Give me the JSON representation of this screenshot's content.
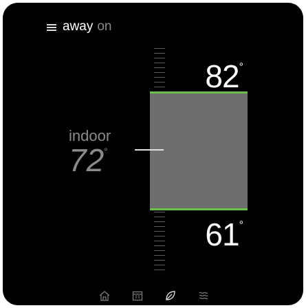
{
  "header": {
    "mode_label": "away",
    "mode_state": "on"
  },
  "thermostat": {
    "high_setpoint": "82",
    "low_setpoint": "61",
    "degree_symbol": "°",
    "indoor_label": "indoor",
    "indoor_temp": "72"
  },
  "colors": {
    "background": "#000000",
    "range_fill": "#6e6e6e",
    "range_edge": "#6cc04a",
    "text_primary": "#ffffff",
    "text_muted": "#8a8a8a"
  },
  "nav": {
    "items": [
      {
        "icon": "home-icon"
      },
      {
        "icon": "calendar-icon"
      },
      {
        "icon": "leaf-icon"
      },
      {
        "icon": "fan-icon"
      }
    ]
  }
}
